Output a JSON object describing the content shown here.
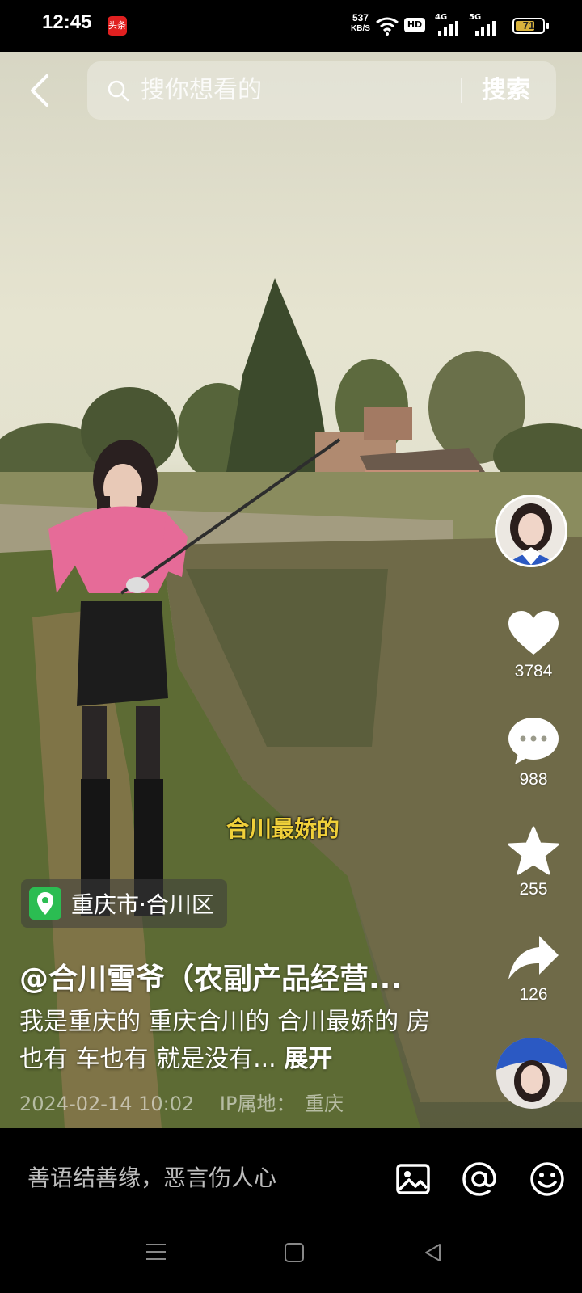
{
  "status_bar": {
    "time": "12:45",
    "app_badge": "头条",
    "net_speed_value": "537",
    "net_speed_unit": "KB/S",
    "hd_label": "HD",
    "signal1_label": "4G",
    "signal2_label": "5G",
    "battery": "71",
    "battery_level": 0.71
  },
  "search": {
    "placeholder": "搜你想看的",
    "button": "搜索"
  },
  "actions": {
    "like_count": "3784",
    "comment_count": "988",
    "favorite_count": "255",
    "share_count": "126"
  },
  "video": {
    "subtitle": "合川最娇的",
    "location": "重庆市·合川区",
    "author": "@合川雪爷（农副产品经营...",
    "description": "我是重庆的 重庆合川的 合川最娇的 房也有 车也有 就是没有...",
    "expand": "展开",
    "date": "2024-02-14 10:02",
    "ip_label": "IP属地：",
    "ip_region": "重庆"
  },
  "comment_bar": {
    "placeholder": "善语结善缘，恶言伤人心"
  },
  "colors": {
    "like": "#ffffff",
    "location_pin": "#2bbd52",
    "subtitle": "#f0d03a",
    "battery_fill": "#d8b23c"
  },
  "icons": [
    "back-icon",
    "search-icon",
    "heart-icon",
    "comment-icon",
    "star-icon",
    "share-icon",
    "image-icon",
    "at-icon",
    "emoji-icon",
    "menu-icon",
    "home-icon",
    "back-nav-icon"
  ]
}
